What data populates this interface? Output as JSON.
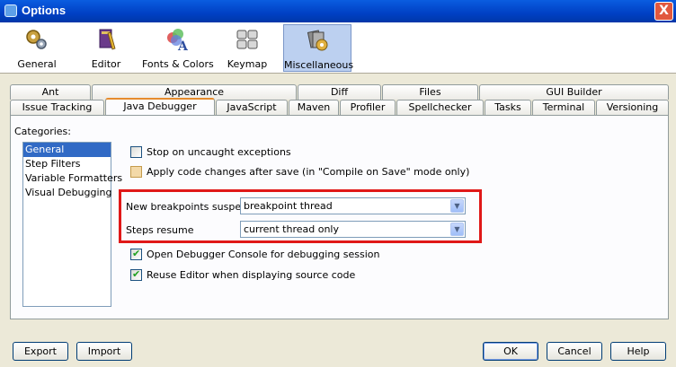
{
  "window": {
    "title": "Options",
    "close_label": "X"
  },
  "toolbar": {
    "items": [
      {
        "label": "General",
        "icon": "gears-icon"
      },
      {
        "label": "Editor",
        "icon": "editor-icon"
      },
      {
        "label": "Fonts & Colors",
        "icon": "fonts-colors-icon"
      },
      {
        "label": "Keymap",
        "icon": "keymap-icon"
      },
      {
        "label": "Miscellaneous",
        "icon": "miscellaneous-icon",
        "selected": true
      }
    ]
  },
  "tabs": {
    "row1": [
      "Ant",
      "Appearance",
      "Diff",
      "Files",
      "GUI Builder"
    ],
    "row2": [
      "Issue Tracking",
      "Java Debugger",
      "JavaScript",
      "Maven",
      "Profiler",
      "Spellchecker",
      "Tasks",
      "Terminal",
      "Versioning"
    ],
    "active": "Java Debugger"
  },
  "categories": {
    "label": "Categories:",
    "items": [
      "General",
      "Step Filters",
      "Variable Formatters",
      "Visual Debugging"
    ],
    "selected": "General"
  },
  "options": {
    "stop_uncaught": {
      "label": "Stop on uncaught exceptions",
      "checked": false
    },
    "apply_changes": {
      "label": "Apply code changes after save (in \"Compile on Save\" mode only)",
      "checked": false
    },
    "breakpoints_suspend": {
      "label": "New breakpoints suspend",
      "value": "breakpoint thread"
    },
    "steps_resume": {
      "label": "Steps resume",
      "value": "current thread only"
    },
    "open_console": {
      "label": "Open Debugger Console for debugging session",
      "checked": true
    },
    "reuse_editor": {
      "label": "Reuse Editor when displaying source code",
      "checked": true
    }
  },
  "buttons": {
    "export": "Export",
    "import": "Import",
    "ok": "OK",
    "cancel": "Cancel",
    "help": "Help"
  },
  "colors": {
    "titlebar": "#0a5de0",
    "highlight": "#e01818",
    "selection": "#316ac5",
    "active_tab": "#e68b2c"
  }
}
